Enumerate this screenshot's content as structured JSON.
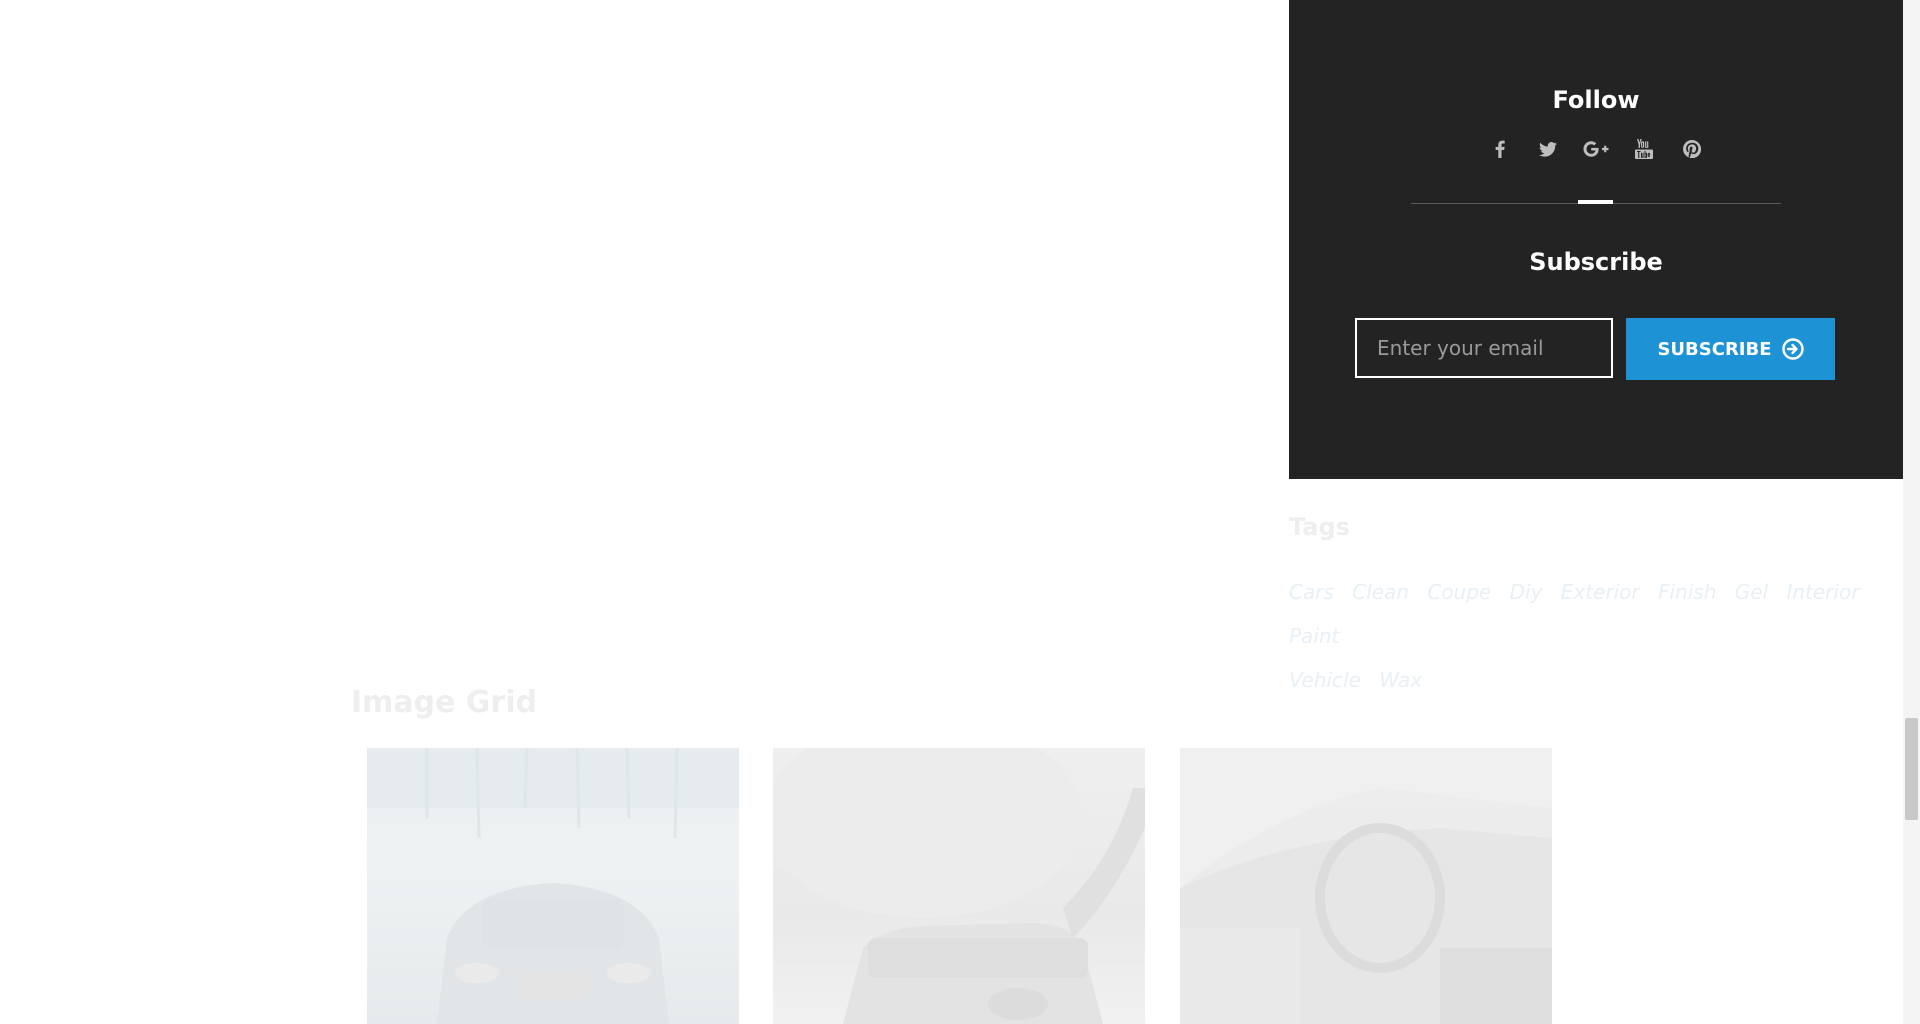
{
  "follow": {
    "title": "Follow",
    "social_icons": [
      "facebook-icon",
      "twitter-icon",
      "google-plus-icon",
      "youtube-icon",
      "pinterest-icon"
    ]
  },
  "subscribe": {
    "title": "Subscribe",
    "email_placeholder": "Enter your email",
    "button_label": "SUBSCRIBE"
  },
  "tags": {
    "title": "Tags",
    "items": [
      "Cars",
      "Clean",
      "Coupe",
      "Diy",
      "Exterior",
      "Finish",
      "Gel",
      "Interior",
      "Paint",
      "Vehicle",
      "Wax"
    ]
  },
  "image_grid": {
    "title": "Image Grid"
  },
  "colors": {
    "widget_bg": "#232323",
    "accent": "#1d93d5"
  }
}
